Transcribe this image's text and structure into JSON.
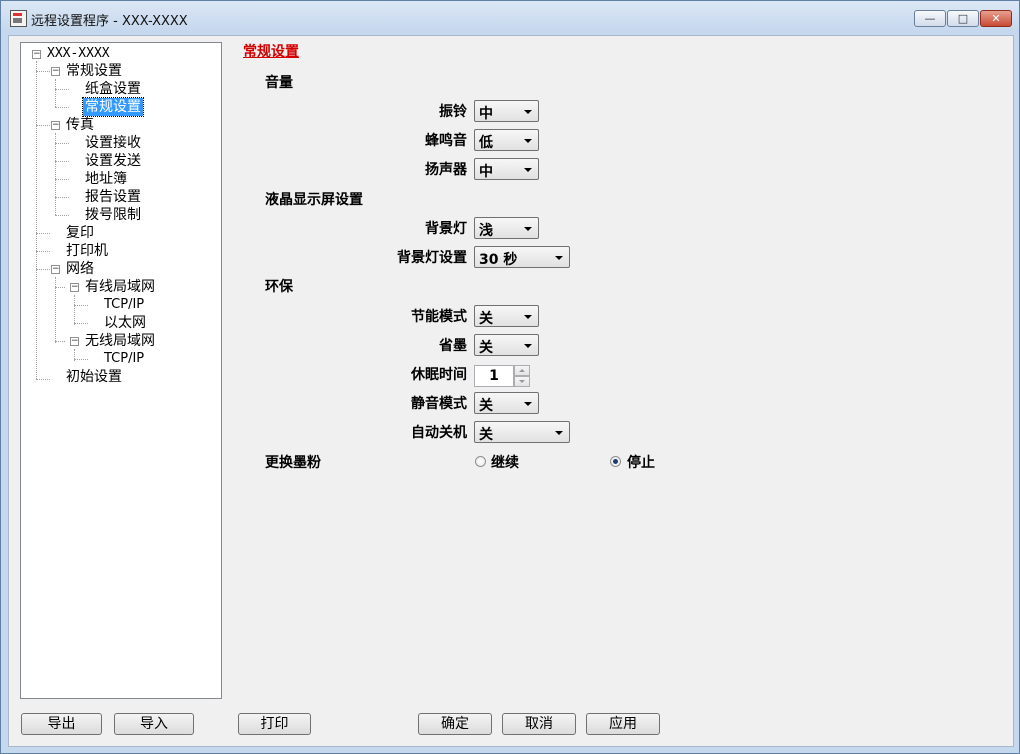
{
  "window": {
    "title": "远程设置程序 - XXX-XXXX",
    "min_glyph": "—",
    "max_glyph": "□",
    "close_glyph": "✕"
  },
  "tree": {
    "root": "XXX-XXXX",
    "general": "常规设置",
    "tray": "纸盒设置",
    "general_sub": "常规设置",
    "fax": "传真",
    "recv": "设置接收",
    "send": "设置发送",
    "addr": "地址簿",
    "report": "报告设置",
    "dial": "拨号限制",
    "copy": "复印",
    "printer": "打印机",
    "network": "网络",
    "wired": "有线局域网",
    "wired_tcpip": "TCP/IP",
    "ethernet": "以太网",
    "wlan": "无线局域网",
    "wlan_tcpip": "TCP/IP",
    "initial": "初始设置"
  },
  "panel": {
    "title": "常规设置",
    "volume": {
      "heading": "音量",
      "ring_label": "振铃",
      "ring_value": "中",
      "beep_label": "蜂鸣音",
      "beep_value": "低",
      "speaker_label": "扬声器",
      "speaker_value": "中"
    },
    "lcd": {
      "heading": "液晶显示屏设置",
      "backlight_label": "背景灯",
      "backlight_value": "浅",
      "timer_label": "背景灯设置",
      "timer_value": "30 秒"
    },
    "eco": {
      "heading": "环保",
      "saving_label": "节能模式",
      "saving_value": "关",
      "toner_label": "省墨",
      "toner_value": "关",
      "sleep_label": "休眠时间",
      "sleep_value": "1",
      "quiet_label": "静音模式",
      "quiet_value": "关",
      "autooff_label": "自动关机",
      "autooff_value": "关"
    },
    "toner_replace": {
      "label": "更换墨粉",
      "continue": "继续",
      "stop": "停止",
      "selected": "stop"
    }
  },
  "buttons": {
    "export": "导出",
    "import": "导入",
    "print": "打印",
    "ok": "确定",
    "cancel": "取消",
    "apply": "应用"
  }
}
